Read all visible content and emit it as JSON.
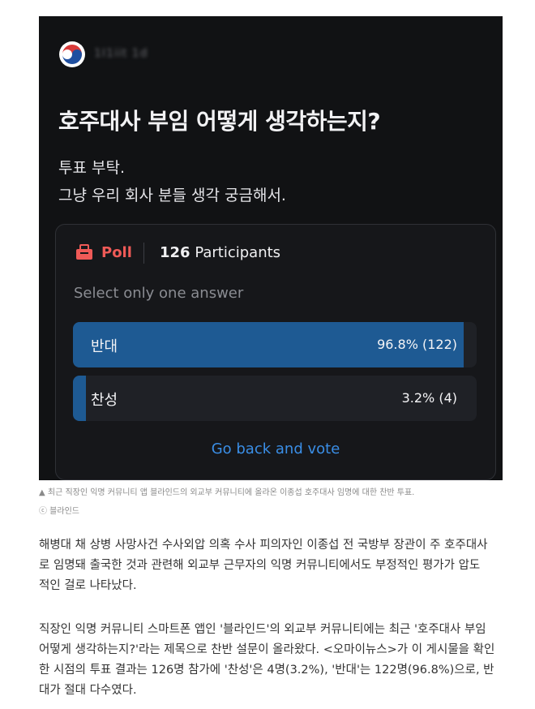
{
  "post": {
    "author": "1I1iit  1d",
    "title": "호주대사 부임 어떻게 생각하는지?",
    "body_lines": [
      "투표 부탁.",
      "그냥 우리 회사 분들 생각 궁금해서."
    ]
  },
  "poll": {
    "label": "Poll",
    "participants_count": "126",
    "participants_label": "Participants",
    "hint": "Select only one answer",
    "options": [
      {
        "label": "반대",
        "result": "96.8% (122)",
        "share": 0.968
      },
      {
        "label": "찬성",
        "result": "3.2% (4)",
        "share": 0.032
      }
    ],
    "back_link": "Go back and vote"
  },
  "colors": {
    "poll_accent": "#ef5a57",
    "bar_fill": "#1e5a93",
    "link": "#3a8ee6"
  },
  "article": {
    "caption": "▲ 최근 직장인 익명 커뮤니티 앱 블라인드의 외교부 커뮤니티에 올라온 이종섭 호주대사 임명에 대한 찬반 투표.",
    "credit": "ⓒ 블라인드",
    "paragraph1": [
      "해병대 채 상병 사망사건 수사외압 의혹 수사 피의자인 이종섭 전 국방부 장관이 주 호주대사",
      "로 임명돼 출국한 것과 관련해 외교부 근무자의 익명 커뮤니티에서도 부정적인 평가가 압도",
      "적인 걸로 나타났다."
    ],
    "paragraph2": [
      "직장인 익명 커뮤니티 스마트폰 앱인 '블라인드'의 외교부 커뮤니티에는 최근 '호주대사 부임",
      "어떻게 생각하는지?'라는 제목으로 찬반 설문이 올라왔다. <오마이뉴스>가 이 게시물을 확인",
      "한 시점의 투표 결과는 126명 참가에 '찬성'은 4명(3.2%), '반대'는 122명(96.8%)으로, 반",
      "대가 절대 다수였다."
    ]
  }
}
